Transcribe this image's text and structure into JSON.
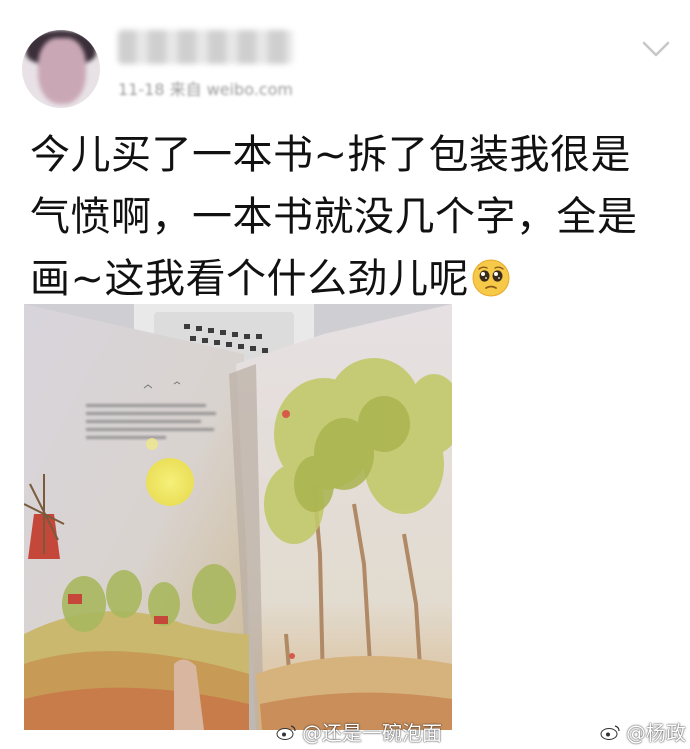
{
  "post": {
    "author_name": "",
    "meta": "11-18   来自   weibo.com",
    "text_lines": [
      "今儿买了一本书~拆了包装我很是",
      "气愤啊，一本书就没几个字，全是",
      "画~这我看个什么劲儿呢"
    ],
    "emoji": "pleading-face-emoji"
  },
  "watermarks": {
    "left": "@还是一碗泡面",
    "right": "@杨政"
  },
  "icons": {
    "more": "chevron-down-icon",
    "weibo": "weibo-logo-icon"
  },
  "colors": {
    "text": "#111111",
    "meta": "#9b9b9b",
    "chevron": "#c8c8c8"
  }
}
